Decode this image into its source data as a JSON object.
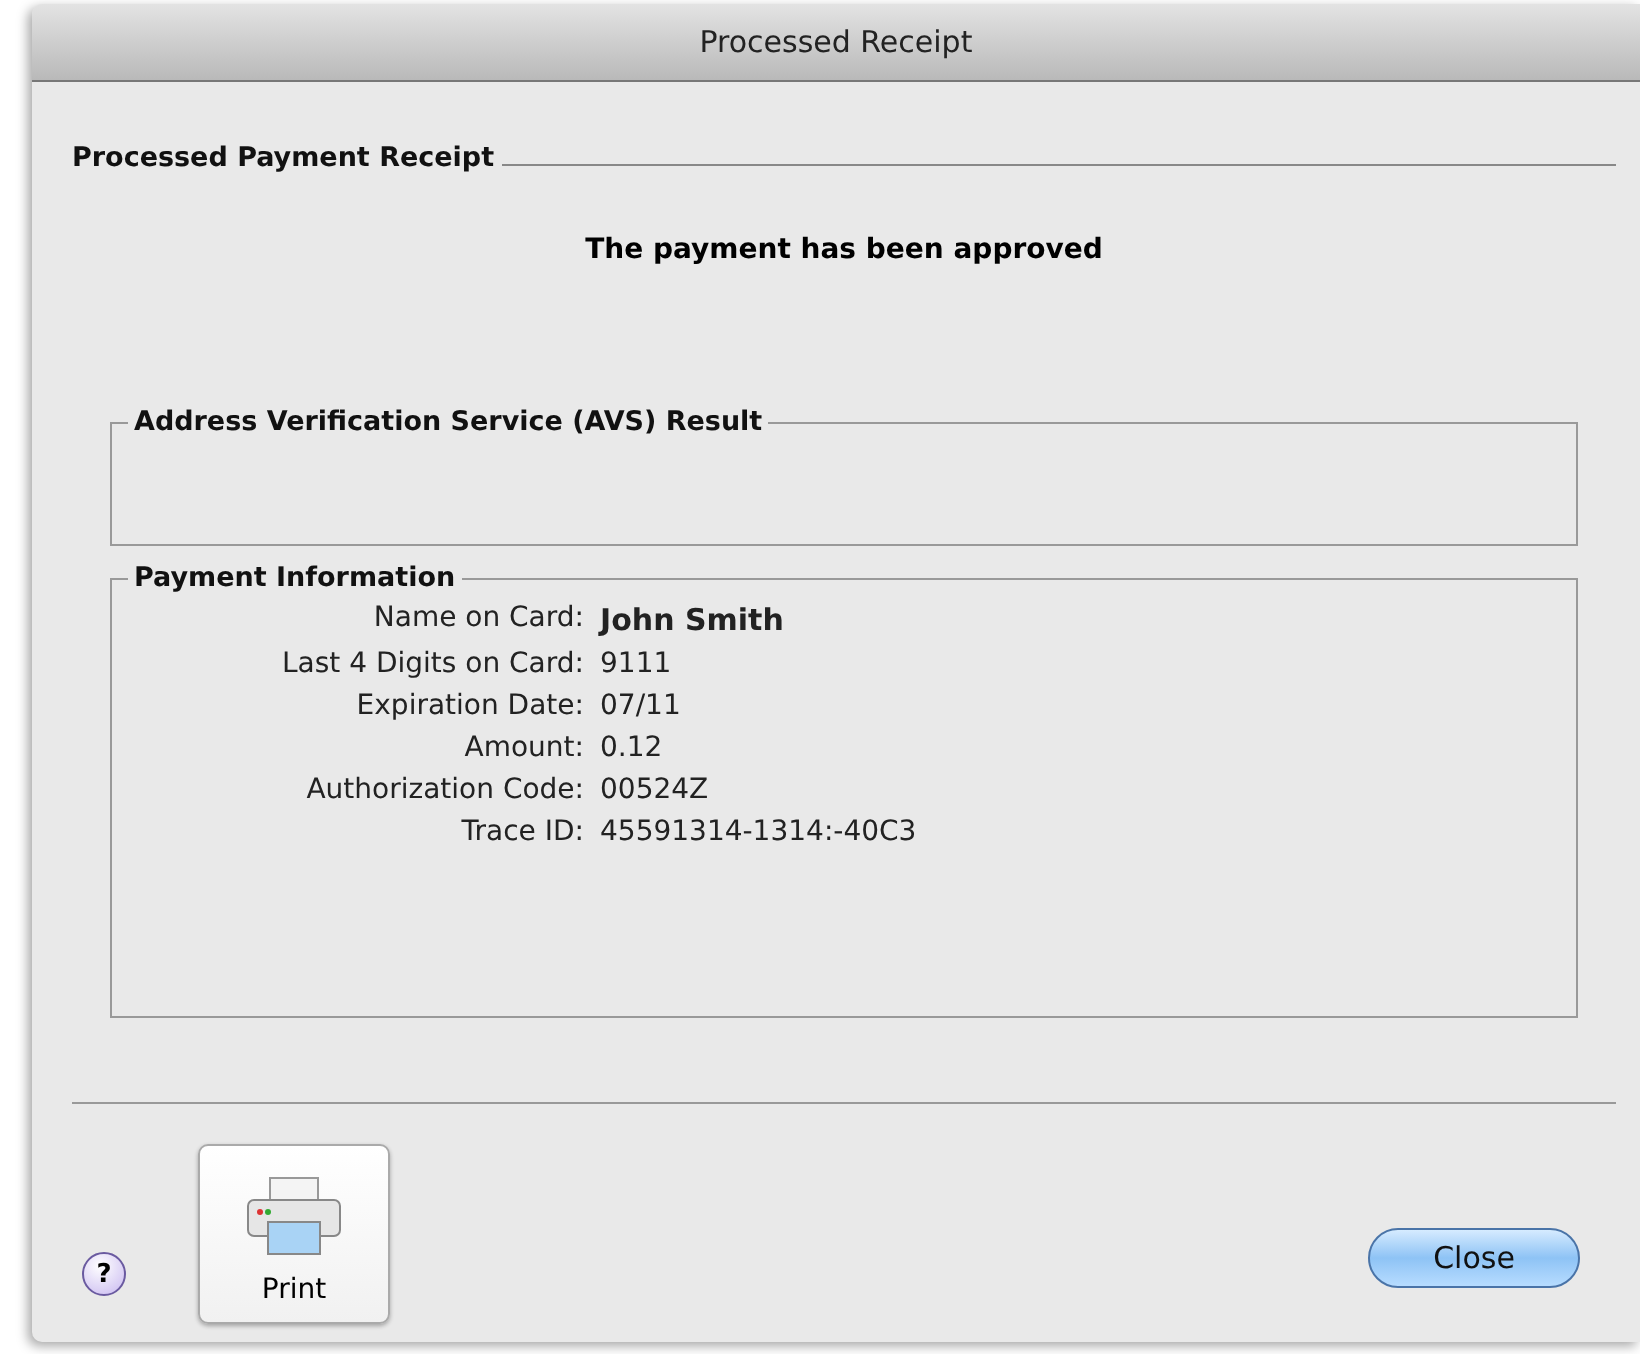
{
  "window": {
    "title": "Processed Receipt"
  },
  "section": {
    "title": "Processed Payment Receipt"
  },
  "message": "The payment has been approved",
  "avs": {
    "title": "Address Verification Service (AVS) Result"
  },
  "payment": {
    "title": "Payment Information",
    "fields": [
      {
        "label": "Name on Card:",
        "value": "John Smith",
        "emphasis": true
      },
      {
        "label": "Last 4 Digits on Card:",
        "value": "9111",
        "emphasis": false
      },
      {
        "label": "Expiration Date:",
        "value": "07/11",
        "emphasis": false
      },
      {
        "label": "Amount:",
        "value": "0.12",
        "emphasis": false
      },
      {
        "label": "Authorization Code:",
        "value": "00524Z",
        "emphasis": false
      },
      {
        "label": "Trace ID:",
        "value": "45591314-1314:-40C3",
        "emphasis": false
      }
    ]
  },
  "help_button": "?",
  "print_button": "Print",
  "close_button": "Close"
}
